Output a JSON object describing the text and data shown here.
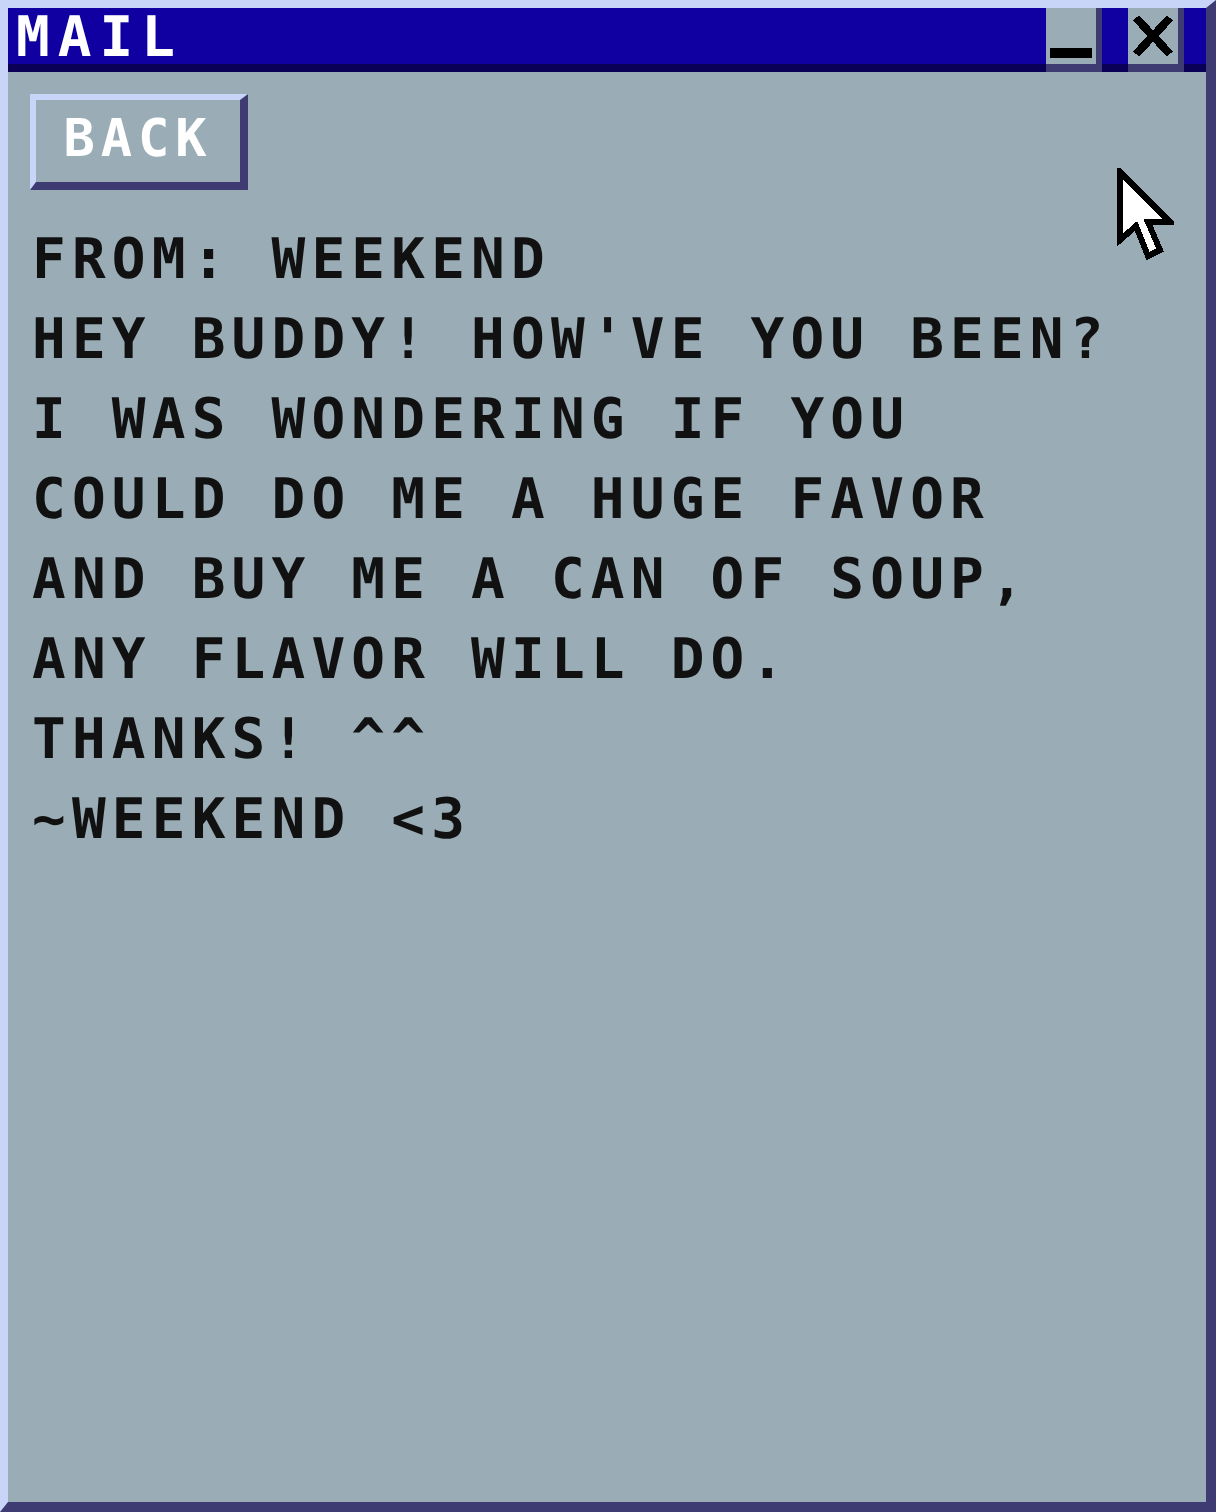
{
  "window": {
    "title": "MAIL",
    "controls": [
      {
        "kind": "minimize"
      },
      {
        "kind": "close"
      }
    ]
  },
  "back_button": {
    "label": "BACK"
  },
  "mail": {
    "from": "FROM: WEEKEND",
    "body": "HEY BUDDY! HOW'VE YOU BEEN?\nI WAS WONDERING IF YOU\nCOULD DO ME A HUGE FAVOR\nAND BUY ME A CAN OF SOUP,\nANY FLAVOR WILL DO.",
    "sign_off": "THANKS! ^^",
    "signature": "~WEEKEND <3"
  },
  "cursor": {
    "kind": "arrow"
  }
}
